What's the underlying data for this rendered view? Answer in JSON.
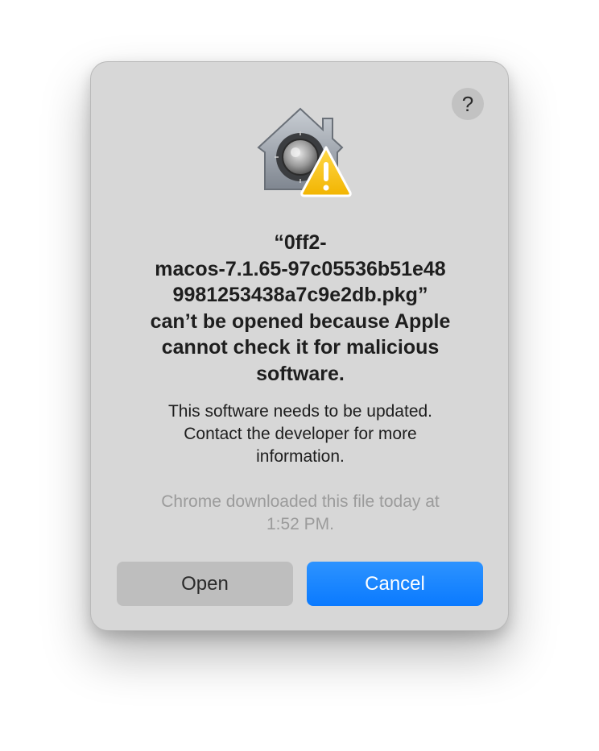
{
  "dialog": {
    "help_label": "?",
    "icon": "gatekeeper-security-icon",
    "warning_icon": "warning-triangle-icon",
    "title_lines": [
      "“0ff2-",
      "macos-7.1.65-97c05536b51e48",
      "9981253438a7c9e2db.pkg”",
      "can’t be opened because Apple",
      "cannot check it for malicious",
      "software."
    ],
    "message_lines": [
      "This software needs to be updated.",
      "Contact the developer for more",
      "information."
    ],
    "detail_lines": [
      "Chrome downloaded this file today at",
      "1:52 PM."
    ],
    "buttons": {
      "open": "Open",
      "cancel": "Cancel"
    }
  },
  "colors": {
    "dialog_bg": "#d7d7d7",
    "accent": "#0a7aff",
    "secondary_text": "#9b9b9b"
  }
}
